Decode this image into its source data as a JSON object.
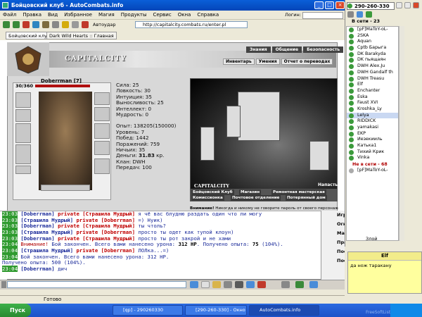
{
  "window": {
    "title": "Бойцовский клуб - AutoCombats.info"
  },
  "menu": [
    "Файл",
    "Правка",
    "Вид",
    "Избранное",
    "Магия",
    "Продукты",
    "Сервис",
    "Окна",
    "Справка"
  ],
  "toolbar": {
    "autoudar": "Автоудар",
    "logins_label": "Логин:"
  },
  "address": {
    "url": "http://capitalcity.combats.ru/enter.pl"
  },
  "tabs": [
    {
      "label": "Бойцовский клуб",
      "active": true
    },
    {
      "label": "Dark Wild Hearts :: Главная",
      "active": false
    }
  ],
  "game": {
    "brand": "CAPITALCITY",
    "top_nav": [
      "Знания",
      "Общение",
      "Безопасность"
    ],
    "sub_nav": [
      "Инвентарь",
      "Умения",
      "Отчет о переводах"
    ],
    "hp": "30/360",
    "char_name": "Doberrman",
    "char_level": "[7]",
    "stats": {
      "sila": "Сила: 25",
      "lovk": "Ловкость: 30",
      "intu": "Интуиция: 35",
      "vyn": "Выносливость: 25",
      "intel": "Интеллект: 0",
      "mudr": "Мудрость: 0",
      "opyt": "Опыт: 138205(150000)",
      "level": "Уровень: 7",
      "wins": "Побед: 1442",
      "losses": "Поражений: 759",
      "draws": "Ничьих: 35",
      "money_label": "Деньги: ",
      "money_value": "31.83",
      "money_unit": " кр.",
      "clan": "Клан: DWH",
      "transfers": "Передач: 100"
    },
    "scene_label": "CAPITALCITY",
    "scene_btn": "Напасть",
    "city_nav": [
      "Бойцовский Клуб",
      "Магазин",
      "Ремонтная мастерская",
      "Комиссионка",
      "Почтовое отделение",
      "Потерянный дом"
    ],
    "warning_label": "Внимание!",
    "warning_text": " Никогда и никому не говорите пароль от своего персонаж"
  },
  "chat": [
    {
      "time": "23:03",
      "from": "[Doberrman]",
      "kind": "private",
      "to": "[Страшила Мудрый]",
      "text": "я чё вас блудню раздать один что ли могу"
    },
    {
      "time": "23:03",
      "from": "[Страшила Мудрый]",
      "kind": "private",
      "to": "[Doberrman]",
      "text": "=) Нуик)"
    },
    {
      "time": "23:03",
      "from": "[Doberrman]",
      "kind": "private",
      "to": "[Страшила Мудрый]",
      "text": "ты чтоль?"
    },
    {
      "time": "23:03",
      "from": "[Страшила Мудрый]",
      "kind": "private",
      "to": "[Doberrman]",
      "text": "просто ты одет как тупой клоун)"
    },
    {
      "time": "23:03",
      "from": "[Doberrman]",
      "kind": "private",
      "to": "[Страшила Мудрый]",
      "text": "просто ты рот закрой и не хами"
    }
  ],
  "chat_sys1": {
    "time": "23:04",
    "label": "Внимание!",
    "pre": " Бой закончен. Всего вами нанесено урона: ",
    "hp": "312 HP",
    "mid": ". Получено опыта: ",
    "exp": "75",
    "post": " (104%)."
  },
  "chat_line7": {
    "time": "23:04",
    "from": "[Страшила Мудрый]",
    "kind": "private",
    "to": "[Doberrman]",
    "text": "ЛОЛка...=)"
  },
  "chat_sys2": {
    "time": "23:04",
    "pre": "Бой закончен. Всего вами нанесено урона: 312 HP."
  },
  "chat_sys2b": "Получено опыта: 500 (104%).",
  "chat_line9": {
    "time": "23:04",
    "from": "[Doberrman]",
    "text": "дич"
  },
  "right_chat_names": [
    "Игро",
    "Огн",
    "Mar",
    "Прайн",
    "Пос",
    "Пос"
  ],
  "status": {
    "text": "Готово"
  },
  "taskbar": {
    "start": "Пуск",
    "tasks": [
      {
        "label": "[qp] - 290260330",
        "active": false
      },
      {
        "label": "[290-260-330] - Окно со...",
        "active": false
      },
      {
        "label": "AutoCombats.info",
        "active": true
      }
    ],
    "clock": ""
  },
  "roster": {
    "title": "290-260-330",
    "online_header": "В сети - 23",
    "contacts": [
      "[pF]MaToY-oL-",
      "2SKA",
      "Aquan",
      "Cptb Барыга",
      "DK Barakyda",
      "DK пьящаян",
      "DWH Alex.Ju",
      "DWH Gandalf th",
      "DWH Treasu",
      "Elf",
      "Enchanter",
      "Eska",
      "Faust XVI",
      "Kroshka_Ly",
      "Lelya",
      "RIDDICK",
      "yamakasi",
      "EKP",
      "Иезекииль",
      "Катька1",
      "Тихий Крик",
      "Vinka"
    ],
    "selected": "Lelya",
    "offline_header": "Не в сети - 68",
    "offline": [
      "[pF]MaToY-oL-"
    ],
    "mode": "Злой"
  },
  "popup": {
    "title": "Elf",
    "text": "да нож таракану"
  },
  "watermark": "FreeSoftList"
}
